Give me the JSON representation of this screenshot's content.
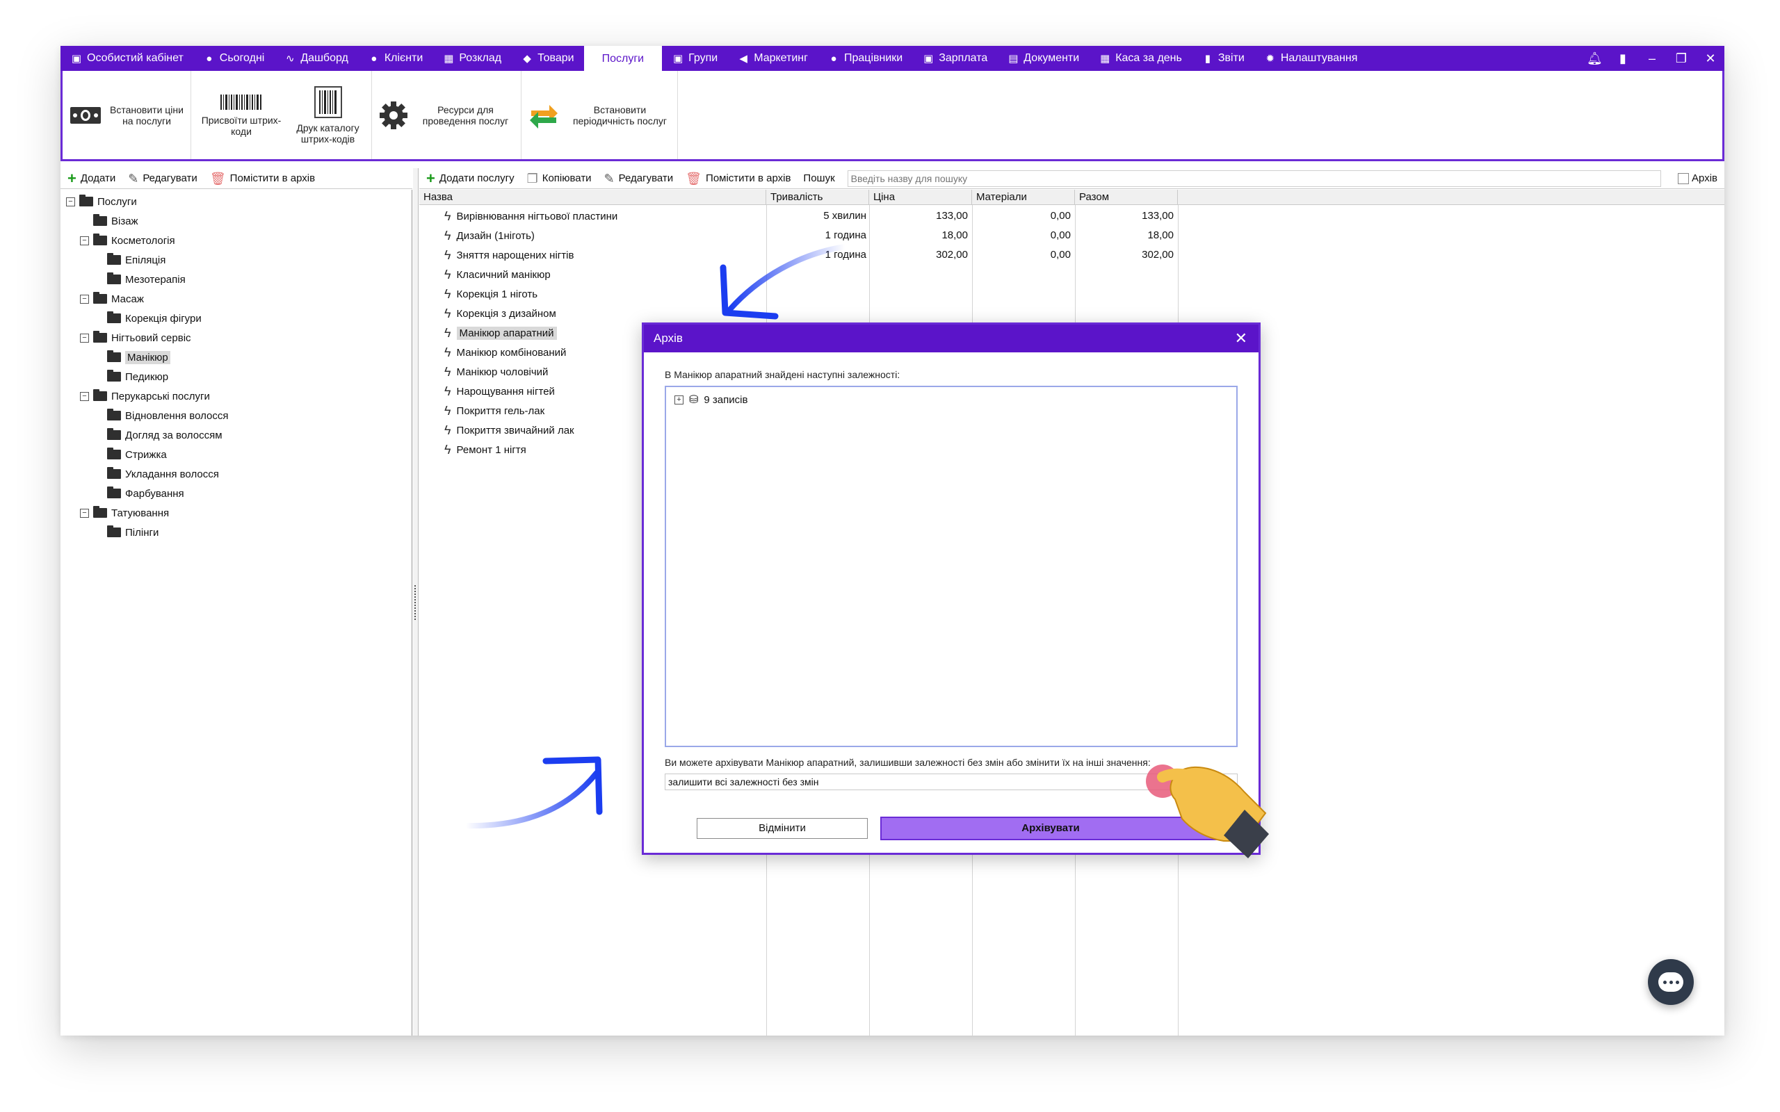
{
  "menu": {
    "items": [
      {
        "label": "Особистий кабінет",
        "icon": "briefcase-icon",
        "glyph": "▣"
      },
      {
        "label": "Сьогодні",
        "icon": "clock-icon",
        "glyph": "●"
      },
      {
        "label": "Дашборд",
        "icon": "pulse-icon",
        "glyph": "∿"
      },
      {
        "label": "Клієнти",
        "icon": "user-circle-icon",
        "glyph": "●"
      },
      {
        "label": "Розклад",
        "icon": "calendar-icon",
        "glyph": "▦"
      },
      {
        "label": "Товари",
        "icon": "box-icon",
        "glyph": "◆"
      },
      {
        "label": "Послуги",
        "icon": "",
        "glyph": ""
      },
      {
        "label": "Групи",
        "icon": "groups-icon",
        "glyph": "▣"
      },
      {
        "label": "Маркетинг",
        "icon": "megaphone-icon",
        "glyph": "◀"
      },
      {
        "label": "Працівники",
        "icon": "person-icon",
        "glyph": "●"
      },
      {
        "label": "Зарплата",
        "icon": "money-icon",
        "glyph": "▣"
      },
      {
        "label": "Документи",
        "icon": "document-icon",
        "glyph": "▤"
      },
      {
        "label": "Каса за день",
        "icon": "calculator-icon",
        "glyph": "▦"
      },
      {
        "label": "Звіти",
        "icon": "bar-chart-icon",
        "glyph": "▮"
      },
      {
        "label": "Налаштування",
        "icon": "gear-icon",
        "glyph": "✹"
      }
    ],
    "active_index": 6,
    "accent": "#5b14c9"
  },
  "ribbon": {
    "set_prices": "Встановити ціни на послуги",
    "assign_barcodes": "Присвоїти штрих-коди",
    "print_barcodes": "Друк каталогу штрих-кодів",
    "resources": "Ресурси для проведення послуг",
    "periodicity": "Встановити періодичність послуг"
  },
  "left_toolbar": {
    "add": "Додати",
    "edit": "Редагувати",
    "archive": "Помістити в архів"
  },
  "tree": [
    {
      "label": "Послуги",
      "level": 0,
      "expander": "−"
    },
    {
      "label": "Візаж",
      "level": 1,
      "expander": ""
    },
    {
      "label": "Косметологія",
      "level": 1,
      "expander": "−"
    },
    {
      "label": "Епіляція",
      "level": 2,
      "expander": ""
    },
    {
      "label": "Мезотерапія",
      "level": 2,
      "expander": ""
    },
    {
      "label": "Масаж",
      "level": 1,
      "expander": "−"
    },
    {
      "label": "Корекція фігури",
      "level": 2,
      "expander": ""
    },
    {
      "label": "Нігтьовий сервіс",
      "level": 1,
      "expander": "−"
    },
    {
      "label": "Манікюр",
      "level": 2,
      "expander": "",
      "selected": true
    },
    {
      "label": "Педикюр",
      "level": 2,
      "expander": ""
    },
    {
      "label": "Перукарські послуги",
      "level": 1,
      "expander": "−"
    },
    {
      "label": "Відновлення волосся",
      "level": 2,
      "expander": ""
    },
    {
      "label": "Догляд за волоссям",
      "level": 2,
      "expander": ""
    },
    {
      "label": "Стрижка",
      "level": 2,
      "expander": ""
    },
    {
      "label": "Укладання волосся",
      "level": 2,
      "expander": ""
    },
    {
      "label": "Фарбування",
      "level": 2,
      "expander": ""
    },
    {
      "label": "Татуювання",
      "level": 1,
      "expander": "−"
    },
    {
      "label": "Пілінги",
      "level": 2,
      "expander": ""
    }
  ],
  "right_toolbar": {
    "add_service": "Додати послугу",
    "copy": "Копіювати",
    "edit": "Редагувати",
    "archive": "Помістити в архів",
    "search_label": "Пошук",
    "search_placeholder": "Введіть назву для пошуку",
    "archive_check": "Архів"
  },
  "grid": {
    "headers": [
      "Назва",
      "Тривалість",
      "Ціна",
      "Матеріали",
      "Разом"
    ],
    "rows": [
      {
        "name": "Вирівнювання нігтьової пластини",
        "duration": "5 хвилин",
        "price": "133,00",
        "materials": "0,00",
        "total": "133,00"
      },
      {
        "name": "Дизайн (1ніготь)",
        "duration": "1 година",
        "price": "18,00",
        "materials": "0,00",
        "total": "18,00"
      },
      {
        "name": "Зняття нарощених нігтів",
        "duration": "1 година",
        "price": "302,00",
        "materials": "0,00",
        "total": "302,00"
      },
      {
        "name": "Класичний манікюр",
        "duration": "",
        "price": "",
        "materials": "",
        "total": ""
      },
      {
        "name": "Корекція 1 ніготь",
        "duration": "",
        "price": "",
        "materials": "",
        "total": ""
      },
      {
        "name": "Корекція з дизайном",
        "duration": "",
        "price": "",
        "materials": "",
        "total": ""
      },
      {
        "name": "Манікюр апаратний",
        "duration": "",
        "price": "",
        "materials": "",
        "total": "",
        "selected": true
      },
      {
        "name": "Манікюр комбінований",
        "duration": "",
        "price": "",
        "materials": "",
        "total": ""
      },
      {
        "name": "Манікюр чоловічий",
        "duration": "",
        "price": "",
        "materials": "",
        "total": ""
      },
      {
        "name": "Нарощування нігтей",
        "duration": "",
        "price": "",
        "materials": "",
        "total": ""
      },
      {
        "name": "Покриття гель-лак",
        "duration": "",
        "price": "",
        "materials": "",
        "total": ""
      },
      {
        "name": "Покриття звичайний лак",
        "duration": "",
        "price": "",
        "materials": "",
        "total": ""
      },
      {
        "name": "Ремонт 1 нігтя",
        "duration": "",
        "price": "",
        "materials": "",
        "total": ""
      }
    ]
  },
  "dialog": {
    "title": "Архів",
    "close": "✕",
    "message": "В Манікюр апаратний знайдені наступні залежності:",
    "dependency": "9 записів",
    "hint": "Ви можете архівувати Манікюр апаратний, залишивши залежності без змін або змінити їх на інші значення:",
    "select_value": "залишити всі залежності без змін",
    "cancel": "Відмінити",
    "confirm": "Архівувати"
  }
}
